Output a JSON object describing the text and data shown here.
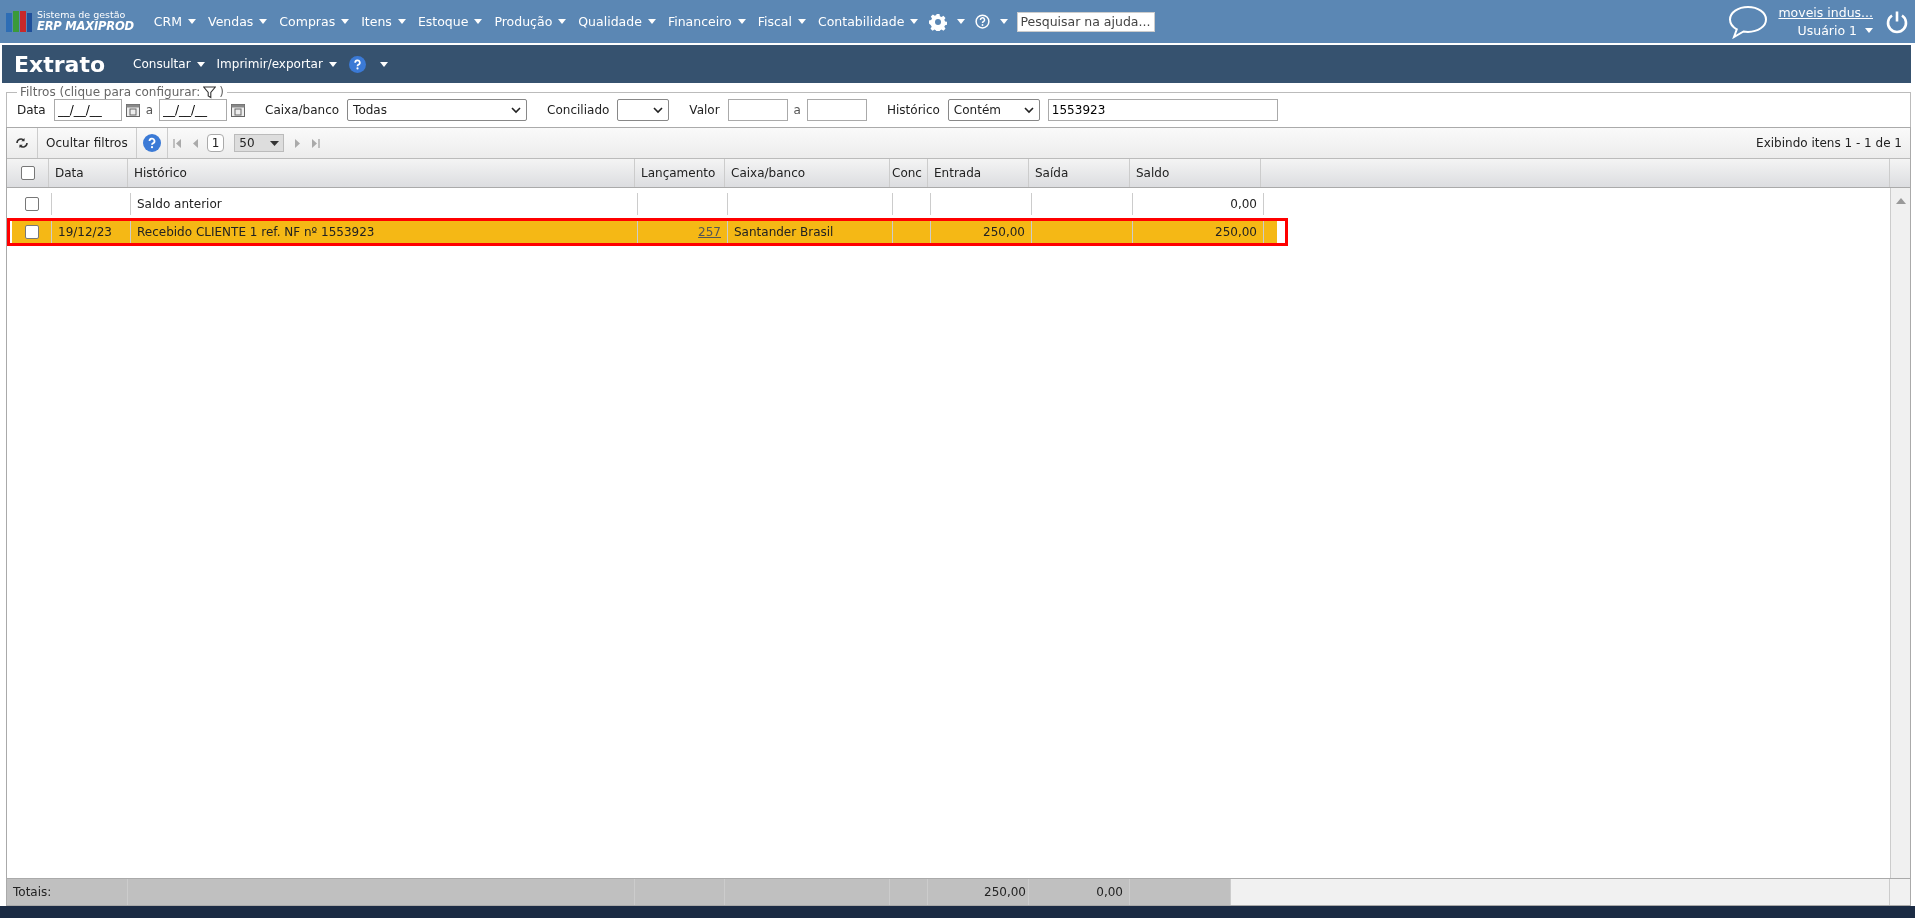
{
  "app": {
    "logo_line1": "Sistema de gestão",
    "logo_line2": "ERP MAXIPROD"
  },
  "menu": [
    {
      "label": "CRM"
    },
    {
      "label": "Vendas"
    },
    {
      "label": "Compras"
    },
    {
      "label": "Itens"
    },
    {
      "label": "Estoque"
    },
    {
      "label": "Produção"
    },
    {
      "label": "Qualidade"
    },
    {
      "label": "Financeiro"
    },
    {
      "label": "Fiscal"
    },
    {
      "label": "Contabilidade"
    }
  ],
  "help_search": {
    "placeholder": "Pesquisar na ajuda..."
  },
  "user": {
    "company": "moveis indus...",
    "name": "Usuário 1"
  },
  "page": {
    "title": "Extrato",
    "actions": [
      "Consultar",
      "Imprimir/exportar"
    ]
  },
  "filters": {
    "legend": "Filtros (clique para configurar:",
    "legend_end": ")",
    "date_label": "Data",
    "date_from": "__/__/__",
    "date_sep": "a",
    "date_to": "__/__/__",
    "bank_label": "Caixa/banco",
    "bank_value": "Todas",
    "reconciled_label": "Conciliado",
    "value_label": "Valor",
    "value_sep": "a",
    "history_label": "Histórico",
    "history_mode": "Contém",
    "history_value": "1553923"
  },
  "toolbar": {
    "hide_filters": "Ocultar filtros",
    "page": "1",
    "page_size": "50",
    "summary": "Exibindo itens 1 - 1 de 1"
  },
  "table": {
    "all_checked": false,
    "columns": [
      "Data",
      "Histórico",
      "Lançamento",
      "Caixa/banco",
      "Conc",
      "Entrada",
      "Saída",
      "Saldo"
    ],
    "rows": [
      {
        "checked": false,
        "selected": false,
        "outlined": false,
        "history": "Saldo anterior",
        "balance": "0,00"
      },
      {
        "checked": false,
        "selected": true,
        "outlined": true,
        "date": "19/12/23",
        "history": "Recebido CLIENTE 1 ref. NF nº 1553923",
        "entry": "257",
        "bank": "Santander Brasil",
        "income": "250,00",
        "balance": "250,00"
      }
    ],
    "totals": {
      "label": "Totais:",
      "income": "250,00",
      "outgo": "0,00"
    }
  }
}
